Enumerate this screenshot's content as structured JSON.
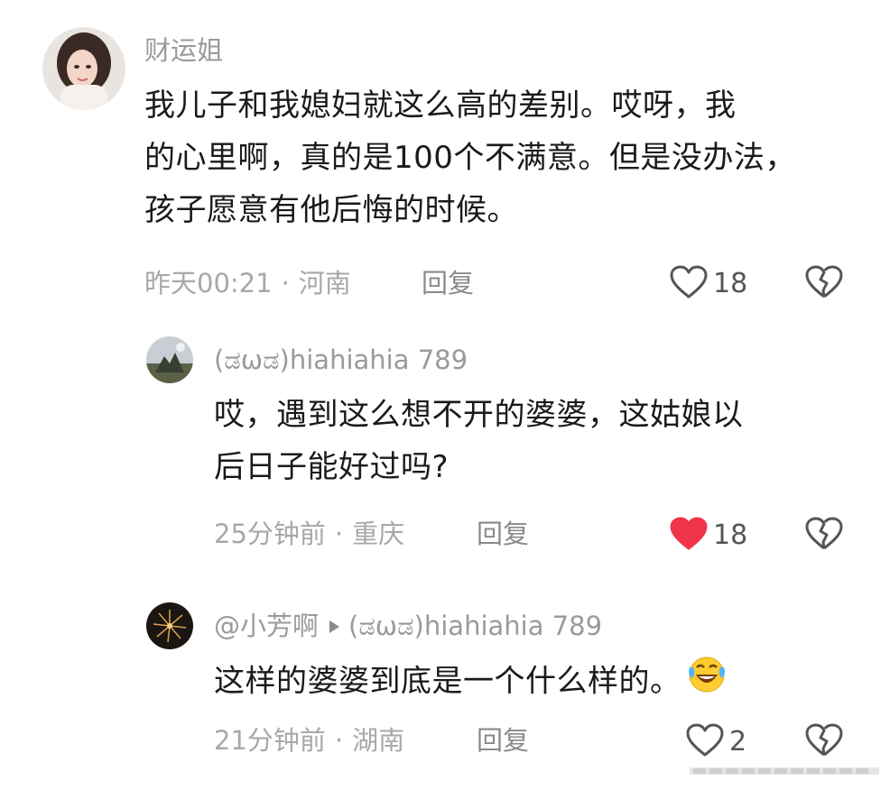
{
  "comments": [
    {
      "username": "财运姐",
      "text_lines": [
        "我儿子和我媳妇就这么高的差别。哎呀，我",
        "的心里啊，真的是100个不满意。但是没办法，",
        "孩子愿意有他后悔的时候。"
      ],
      "time": "昨天00:21",
      "location": "河南",
      "reply_label": "回复",
      "likes": "18",
      "liked": false
    },
    {
      "username": "(ಡωಡ)hiahiahia 789",
      "text_lines": [
        "哎，遇到这么想不开的婆婆，这姑娘以",
        "后日子能好过吗?"
      ],
      "time": "25分钟前",
      "location": "重庆",
      "reply_label": "回复",
      "likes": "18",
      "liked": true
    },
    {
      "username": "@小芳啊",
      "reply_to": "(ಡωಡ)hiahiahia 789",
      "text_lines": [
        "这样的婆婆到底是一个什么样的。"
      ],
      "emoji": "laughing-crying-emoji",
      "time": "21分钟前",
      "location": "湖南",
      "reply_label": "回复",
      "likes": "2",
      "liked": false
    }
  ],
  "separator": "·",
  "colors": {
    "like_active": "#f0354b",
    "icon_stroke": "#555555",
    "meta_gray": "#a8a8a8"
  }
}
